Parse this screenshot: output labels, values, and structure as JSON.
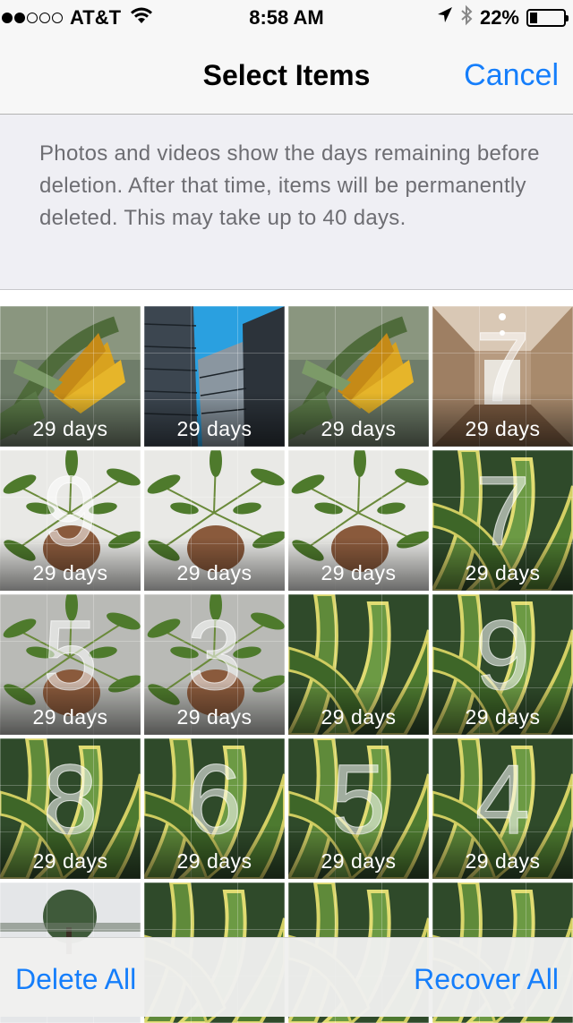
{
  "status_bar": {
    "carrier": "AT&T",
    "time": "8:58 AM",
    "battery": "22%",
    "battery_level": 0.22,
    "signal_bars_filled": 2,
    "signal_bars_total": 5,
    "icons": [
      "wifi-icon",
      "location-arrow-icon",
      "bluetooth-icon",
      "battery-icon"
    ]
  },
  "nav": {
    "title": "Select Items",
    "cancel_label": "Cancel"
  },
  "info": {
    "text": "Photos and videos show the days remaining before deletion. After that time, items will be permanently deleted. This may take up to 40 days."
  },
  "grid": {
    "items": [
      {
        "label": "29 days",
        "subject": "yellow-flower-bud"
      },
      {
        "label": "29 days",
        "subject": "skyscrapers"
      },
      {
        "label": "29 days",
        "subject": "yellow-flower-bud"
      },
      {
        "label": "29 days",
        "subject": "hallway-interior",
        "digit": "7"
      },
      {
        "label": "29 days",
        "subject": "umbrella-plant",
        "digit": "9"
      },
      {
        "label": "29 days",
        "subject": "umbrella-plant"
      },
      {
        "label": "29 days",
        "subject": "umbrella-plant"
      },
      {
        "label": "29 days",
        "subject": "snake-plant",
        "digit": "7"
      },
      {
        "label": "29 days",
        "subject": "umbrella-plant-dim",
        "digit": "5"
      },
      {
        "label": "29 days",
        "subject": "umbrella-plant-dim",
        "digit": "3"
      },
      {
        "label": "29 days",
        "subject": "snake-plant"
      },
      {
        "label": "29 days",
        "subject": "snake-plant",
        "digit": "9"
      },
      {
        "label": "29 days",
        "subject": "snake-plant",
        "digit": "8"
      },
      {
        "label": "29 days",
        "subject": "snake-plant",
        "digit": "6"
      },
      {
        "label": "29 days",
        "subject": "snake-plant",
        "digit": "5"
      },
      {
        "label": "29 days",
        "subject": "snake-plant",
        "digit": "4"
      },
      {
        "label": "",
        "subject": "tree-sky"
      },
      {
        "label": "",
        "subject": "snake-plant"
      },
      {
        "label": "",
        "subject": "snake-plant"
      },
      {
        "label": "",
        "subject": "snake-plant"
      }
    ]
  },
  "toolbar": {
    "delete_all_label": "Delete All",
    "recover_all_label": "Recover All"
  },
  "colors": {
    "accent": "#157efb",
    "info_bg": "#efeff4",
    "info_text": "#6d6d72"
  }
}
